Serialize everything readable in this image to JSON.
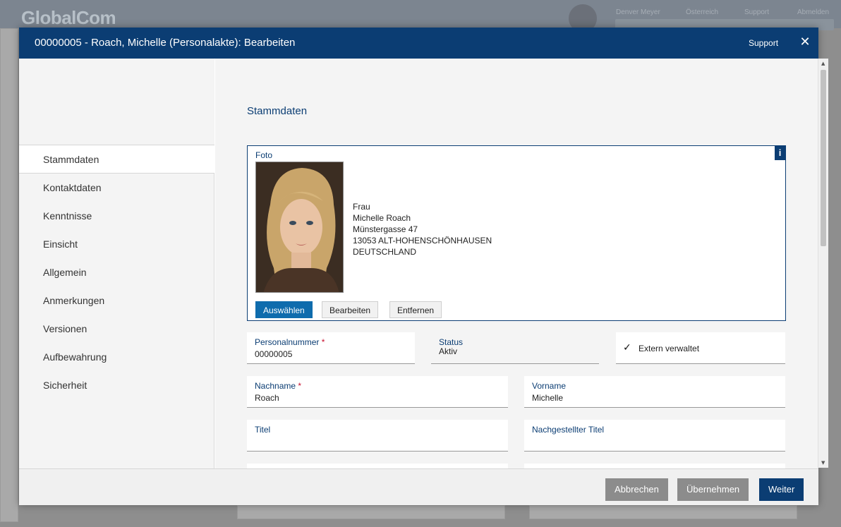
{
  "background": {
    "logo": "GlobalCom",
    "nav": [
      "Denver Meyer",
      "Österreich",
      "Support",
      "Abmelden"
    ]
  },
  "modal": {
    "title": "00000005 - Roach, Michelle (Personalakte): Bearbeiten",
    "support_label": "Support",
    "close_label": "✕"
  },
  "sidebar": {
    "items": [
      {
        "label": "Stammdaten",
        "active": true
      },
      {
        "label": "Kontaktdaten"
      },
      {
        "label": "Kenntnisse"
      },
      {
        "label": "Einsicht"
      },
      {
        "label": "Allgemein"
      },
      {
        "label": "Anmerkungen"
      },
      {
        "label": "Versionen"
      },
      {
        "label": "Aufbewahrung"
      },
      {
        "label": "Sicherheit"
      }
    ]
  },
  "content": {
    "section_title": "Stammdaten",
    "foto": {
      "label": "Foto",
      "info_icon": "i",
      "address_lines": [
        "Frau",
        "Michelle Roach",
        "Münstergasse 47",
        "13053 ALT-HOHENSCHÖNHAUSEN",
        "DEUTSCHLAND"
      ],
      "buttons": {
        "select": "Auswählen",
        "edit": "Bearbeiten",
        "remove": "Entfernen"
      }
    },
    "fields": {
      "personalnummer": {
        "label": "Personalnummer",
        "required": "*",
        "value": "00000005"
      },
      "status": {
        "label": "Status",
        "value": "Aktiv"
      },
      "extern": {
        "label": "Extern verwaltet",
        "checked": true
      },
      "nachname": {
        "label": "Nachname",
        "required": "*",
        "value": "Roach"
      },
      "vorname": {
        "label": "Vorname",
        "value": "Michelle"
      },
      "titel": {
        "label": "Titel",
        "value": ""
      },
      "nachgestellter_titel": {
        "label": "Nachgestellter Titel",
        "value": ""
      }
    }
  },
  "footer": {
    "cancel": "Abbrechen",
    "apply": "Übernehmen",
    "next": "Weiter"
  },
  "colors": {
    "header": "#0b3d73",
    "primary_button": "#0f6cad",
    "required": "#c8102e"
  }
}
